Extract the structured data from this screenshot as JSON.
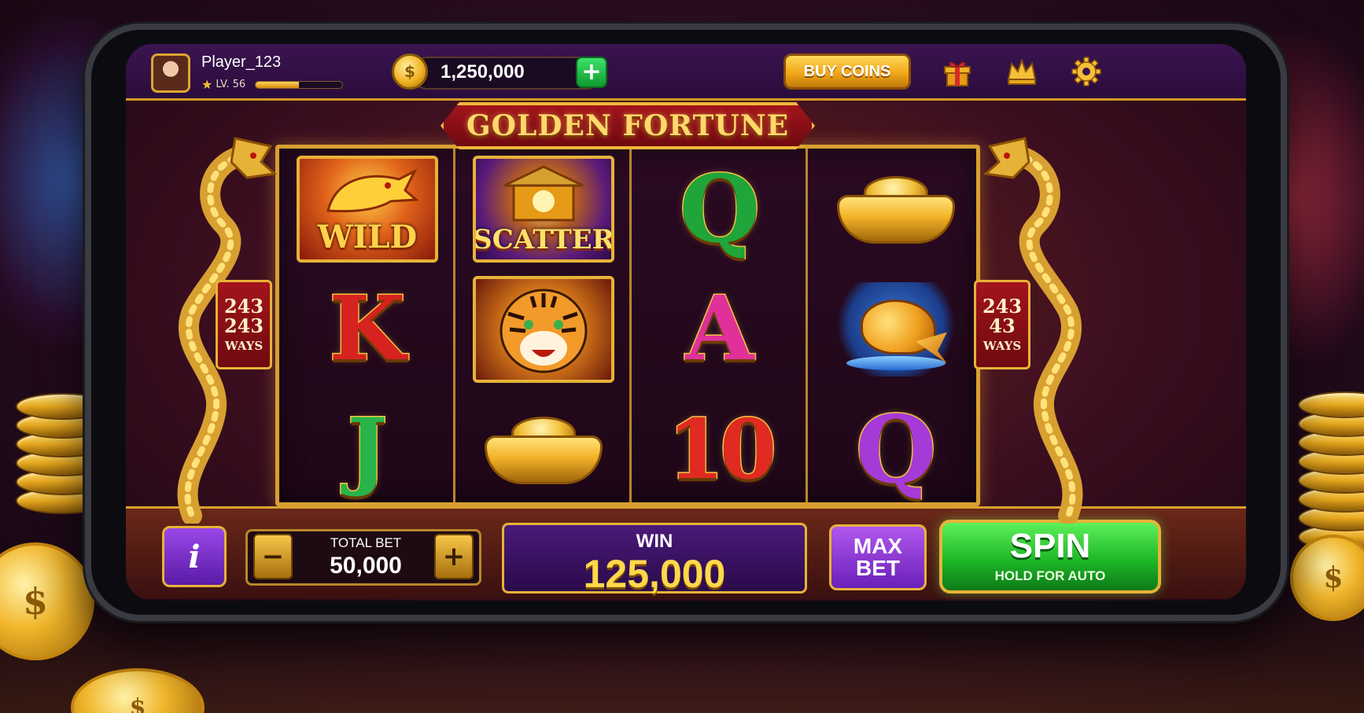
{
  "topbar": {
    "player_name": "Player_123",
    "level": "LV. 56",
    "xp_progress": 0.5,
    "balance": "1,250,000",
    "add_coins_label": "+",
    "buy_coins_label": "BUY COINS",
    "icons": [
      "gift-icon",
      "crown-icon",
      "gear-icon"
    ]
  },
  "game": {
    "title": "GOLDEN FORTUNE",
    "ways_left": {
      "line1": "243",
      "line2": "243",
      "label": "WAYS"
    },
    "ways_right": {
      "line1": "243",
      "line2": "43",
      "label": "WAYS"
    },
    "reels": [
      [
        {
          "type": "wild",
          "label": "WILD"
        },
        {
          "type": "card",
          "label": "K"
        },
        {
          "type": "card",
          "label": "J"
        }
      ],
      [
        {
          "type": "scatter",
          "label": "SCATTER"
        },
        {
          "type": "tiger",
          "label": ""
        },
        {
          "type": "ingot",
          "label": ""
        }
      ],
      [
        {
          "type": "card",
          "label": "Q"
        },
        {
          "type": "card",
          "label": "A"
        },
        {
          "type": "card",
          "label": "10"
        }
      ],
      [
        {
          "type": "ingot",
          "label": ""
        },
        {
          "type": "koi",
          "label": ""
        },
        {
          "type": "card",
          "label": "Q"
        }
      ]
    ]
  },
  "controls": {
    "info_label": "i",
    "bet_minus": "−",
    "bet_plus": "+",
    "total_bet_label": "TOTAL BET",
    "total_bet_value": "50,000",
    "win_label": "WIN",
    "win_value": "125,000",
    "max_bet_line1": "MAX",
    "max_bet_line2": "BET",
    "spin_label": "SPIN",
    "spin_sub": "HOLD FOR AUTO"
  },
  "colors": {
    "gold": "#e7b238",
    "spin_green": "#1eb828",
    "purple": "#6a20b8",
    "banner_red": "#a3141c"
  }
}
